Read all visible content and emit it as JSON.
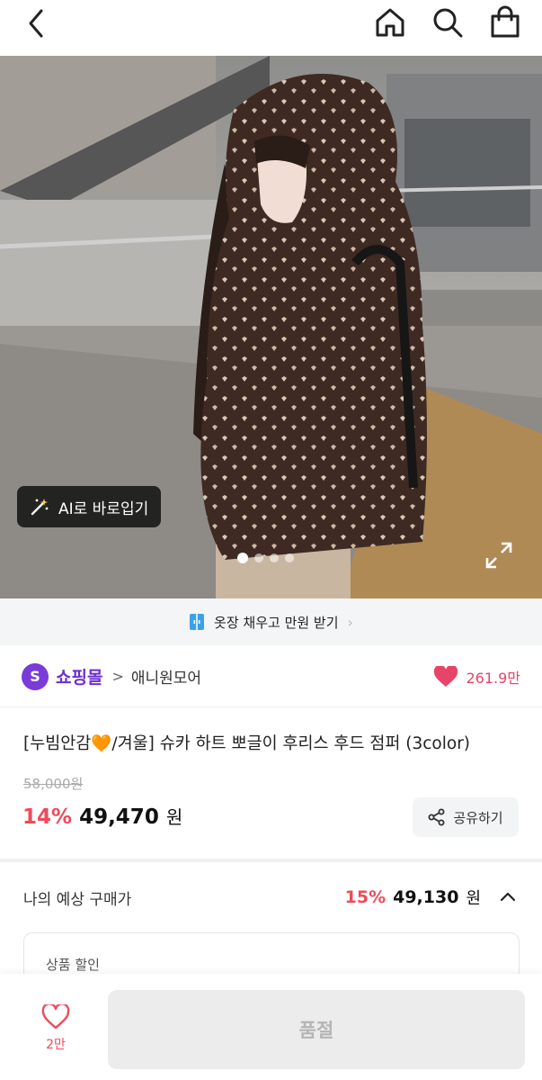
{
  "header": {
    "back_icon": "chevron-left-icon",
    "icons": [
      "home-icon",
      "search-icon",
      "shopping-bag-icon"
    ]
  },
  "hero": {
    "ai_button_label": "AI로 바로입기",
    "ai_icon": "magic-wand-icon",
    "dots_total": 4,
    "active_dot": 0,
    "expand_icon": "expand-icon"
  },
  "coupon_banner": {
    "text": "옷장 채우고 만원 받기",
    "icon": "closet-icon",
    "chevron": "›"
  },
  "shop": {
    "logo_letter": "S",
    "name": "쇼핑몰",
    "separator": ">",
    "brand": "애니원모어",
    "likes": "261.9만"
  },
  "product": {
    "title": "[누빔안감🧡/겨울] 슈카 하트 뽀글이 후리스 후드 점퍼 (3color)",
    "original_price": "58,000원",
    "discount": "14%",
    "price": "49,470",
    "currency": "원",
    "share_label": "공유하기"
  },
  "estimate": {
    "label": "나의 예상 구매가",
    "discount": "15%",
    "price": "49,130",
    "currency": "원"
  },
  "discount_box": {
    "label": "상품 할인"
  },
  "bottom_bar": {
    "wish_count": "2만",
    "soldout_label": "품절"
  },
  "colors": {
    "accent_purple": "#6b2fd0",
    "sale_red": "#ee4b5b",
    "heart_pink": "#e64567"
  }
}
